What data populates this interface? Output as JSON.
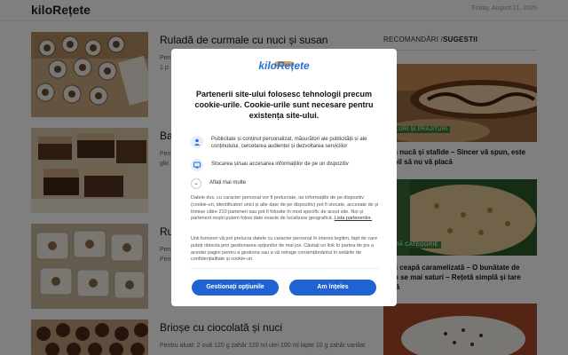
{
  "header": {
    "logo": "kiloRețete",
    "date": "Friday, August 21, 2026"
  },
  "posts": [
    {
      "title": "Ruladă de curmale cu nuci și susan",
      "excerpt_1": "Pen",
      "excerpt_2": "1 p"
    },
    {
      "title": "Ba",
      "excerpt_1": "Pen",
      "excerpt_2": "glic"
    },
    {
      "title": "Ru",
      "excerpt_1": "Pen",
      "excerpt_2": "Pen"
    },
    {
      "title": "Brioșe cu ciocolată și nuci",
      "excerpt_1": "Pentru aluat: 2 ouă 120 g zahăr 120 ml ulei 100 ml lapte 10 g zahăr vanilat",
      "excerpt_2": ""
    }
  ],
  "sidebar": {
    "heading_a": "RECOMANDĂRI /",
    "heading_b": "SUGESTII",
    "cards": [
      {
        "tag": "ULURI ȘI PRĂJITURI",
        "title_1": "ă cu nucă și stafide – Sincer vă spun, este",
        "title_2": "osibil să nu vă placă"
      },
      {
        "tag": "ĂRĂ CATEGORIE",
        "title_1": "e cu ceapă caramelizată – O bunătate de",
        "title_2": "n nu se mai saturi – Rețetă simplă și tare",
        "title_3": "oasă"
      }
    ]
  },
  "consent": {
    "logo": "kiloRețete",
    "title": "Partenerii site-ului folosesc tehnologii precum cookie-urile. Cookie-urile sunt necesare pentru existența site-ului.",
    "item_1": "Publicitate și conținut personalizat, măsurători ale publicității și ale conținutului, cercetarea audienței și dezvoltarea serviciilor",
    "item_2": "Stocarea și/sau accesarea informațiilor de pe un dispozitiv",
    "more": "Aflați mai multe",
    "para_1": "Datele dvs. cu caracter personal vor fi prelucrate, iar informațiile de pe dispozitiv (cookie-uri, identificatori unici și alte date de pe dispozitiv) pot fi stocate, accesate de și trimise către 210 parteneri sau pot fi folosite în mod specific de acest site. Noi și partenerii noștri putem folosi date exacte de localizare geografică.",
    "para_1_link": "Lista partenerilor.",
    "para_2": "Unii furnizori vă pot prelucra datele cu caracter personal în interes legitim, fapt de care puteți obiecta prin gestionarea opțiunilor de mai jos. Căutați un link în partea de jos a acestei pagini pentru a gestiona sau a vă retrage consimțământul în setările de confidențialitate și cookie-uri.",
    "btn_manage": "Gestionați opțiunile",
    "btn_accept": "Am înțeles"
  },
  "colors": {
    "accent": "#1f63d2",
    "overlay": "rgba(0,0,0,0.5)"
  }
}
